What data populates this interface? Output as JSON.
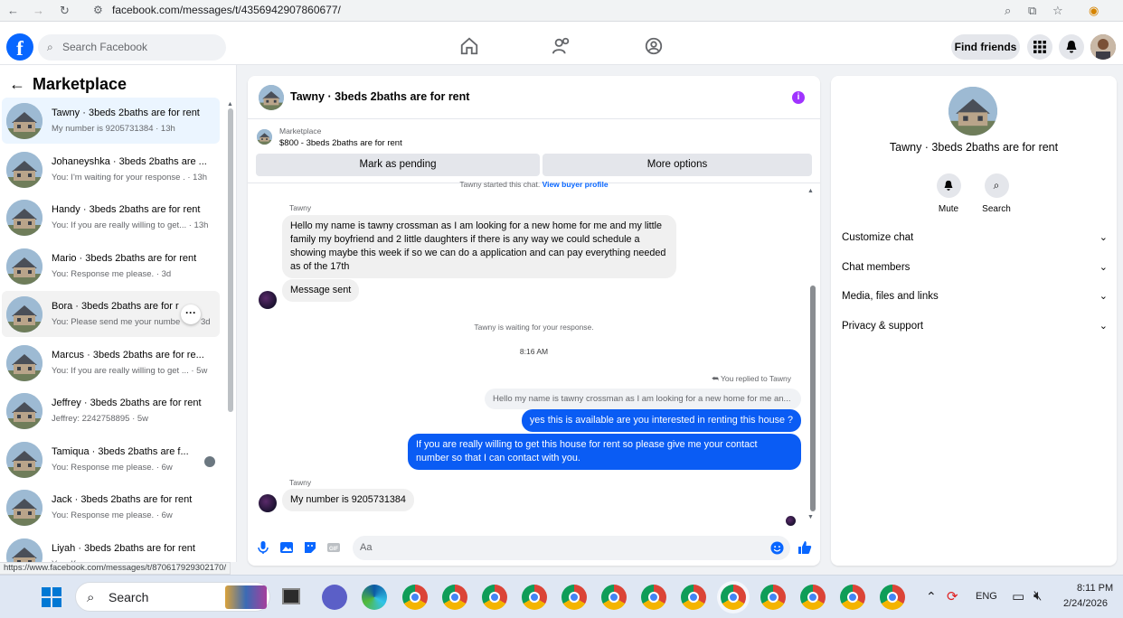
{
  "browser": {
    "url": "facebook.com/messages/t/4356942907860677/"
  },
  "fbnav": {
    "search_placeholder": "Search Facebook",
    "find_friends": "Find friends",
    "logo_letter": "f"
  },
  "marketplace": {
    "title": "Marketplace",
    "conversations": [
      {
        "title": "Tawny · 3beds 2baths are for rent",
        "preview": "My number is 9205731384 · 13h"
      },
      {
        "title": "Johaneyshka · 3beds 2baths are ...",
        "preview": "You: I'm waiting for your response . · 13h"
      },
      {
        "title": "Handy · 3beds 2baths are for rent",
        "preview": "You: If you are really willing to get... · 13h"
      },
      {
        "title": "Mario · 3beds 2baths are for rent",
        "preview": "You: Response me please. · 3d"
      },
      {
        "title": "Bora · 3beds 2baths are for r",
        "preview": "You: Please send me your numbe",
        "preview_tail": "3d"
      },
      {
        "title": "Marcus · 3beds 2baths are for re...",
        "preview": "You: If you are really willing to get ... · 5w"
      },
      {
        "title": "Jeffrey · 3beds 2baths are for rent",
        "preview": "Jeffrey: 2242758895 · 5w"
      },
      {
        "title": "Tamiqua · 3beds 2baths are f...",
        "preview": "You: Response me please. · 6w"
      },
      {
        "title": "Jack · 3beds 2baths are for rent",
        "preview": "You: Response me please. · 6w"
      },
      {
        "title": "Liyah · 3beds 2baths are for rent",
        "preview": "You: If you are..."
      }
    ],
    "status_url": "https://www.facebook.com/messages/t/870617929302170/"
  },
  "chat": {
    "title": "Tawny · 3beds 2baths are for rent",
    "listing_label": "Marketplace",
    "listing_price": "$800 - 3beds 2baths are for rent",
    "mark_pending": "Mark as pending",
    "more_options": "More options",
    "started_note": "Tawny started this chat.",
    "view_buyer": "View buyer profile",
    "sender_name": "Tawny",
    "msg1": "Hello my name is tawny crossman as I am looking for a new home for me and my little family my boyfriend and 2 little daughters if there is any way we could schedule a showing maybe this week if so we can do a application and can pay everything needed as of the 17th",
    "msg_sent": "Message sent",
    "waiting_note": "Tawny is waiting for your response.",
    "time": "8:16 AM",
    "replied_note": "You replied to Tawny",
    "quoted": "Hello my name is tawny crossman as I am looking for a new home for me an...",
    "out1": "yes this is available are you interested in renting this house ?",
    "out2": "If you are really willing to get this house for rent so please give me your contact number so that I  can contact with you.",
    "msg_last": "My number is 9205731384",
    "composer_placeholder": "Aa"
  },
  "details": {
    "title": "Tawny · 3beds 2baths are for rent",
    "mute": "Mute",
    "search": "Search",
    "rows": [
      "Customize chat",
      "Chat members",
      "Media, files and links",
      "Privacy & support"
    ]
  },
  "taskbar": {
    "search": "Search",
    "lang": "ENG",
    "time": "8:11 PM",
    "date": "2/24/2026"
  },
  "colors": {
    "fb_blue": "#0866ff",
    "bubble_out": "#0a5cf4",
    "info_purple": "#a033ff"
  }
}
